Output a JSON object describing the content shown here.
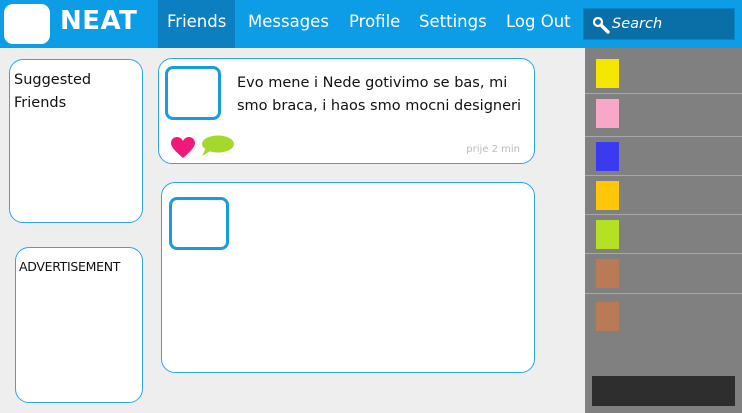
{
  "app": {
    "logo_text": "NEAT"
  },
  "nav": {
    "items": [
      {
        "label": "Friends",
        "active": true
      },
      {
        "label": "Messages",
        "active": false
      },
      {
        "label": "Profile",
        "active": false
      },
      {
        "label": "Settings",
        "active": false
      },
      {
        "label": "Log Out",
        "active": false
      }
    ]
  },
  "search": {
    "placeholder": "Search"
  },
  "left": {
    "suggested_title": "Suggested Friends",
    "ad_label": "ADVERTISEMENT"
  },
  "posts": [
    {
      "text": "Evo mene i Nede gotivimo se bas, mi smo braca, i haos smo mocni designeri",
      "timestamp": "prije 2 min",
      "icons": [
        "heart-icon",
        "comment-icon"
      ]
    },
    {
      "text": "",
      "timestamp": ""
    }
  ],
  "sidebar": {
    "swatches": [
      "#f5e600",
      "#f7a8c8",
      "#3a3af0",
      "#ffc60a",
      "#b5e024",
      "#b97a56",
      "#b97a56"
    ]
  },
  "colors": {
    "topbar": "#0d9de6",
    "topbar_active": "#0b7fbf",
    "panel_border": "#2ea6e8",
    "heart": "#f0197a",
    "comment": "#a5d82c",
    "sidebar_bg": "#808080"
  }
}
